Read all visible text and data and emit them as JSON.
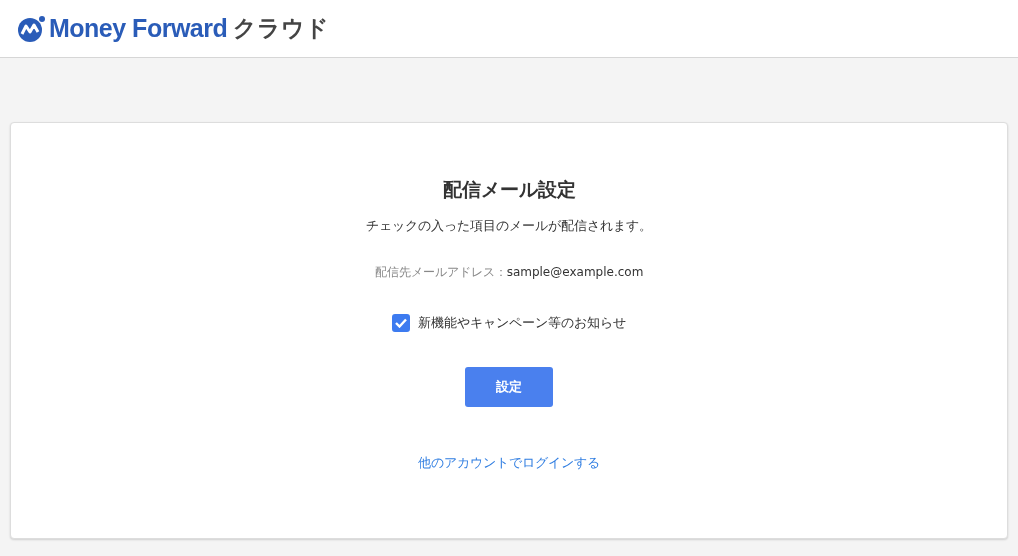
{
  "header": {
    "logo_text": "Money Forward",
    "logo_suffix": "クラウド"
  },
  "card": {
    "title": "配信メール設定",
    "description": "チェックの入った項目のメールが配信されます。",
    "address_label": "配信先メールアドレス：",
    "address": "sample@example.com",
    "options": [
      {
        "label": "新機能やキャンペーン等のお知らせ",
        "checked": true
      }
    ],
    "submit": "設定",
    "link": "他のアカウントでログインする"
  }
}
